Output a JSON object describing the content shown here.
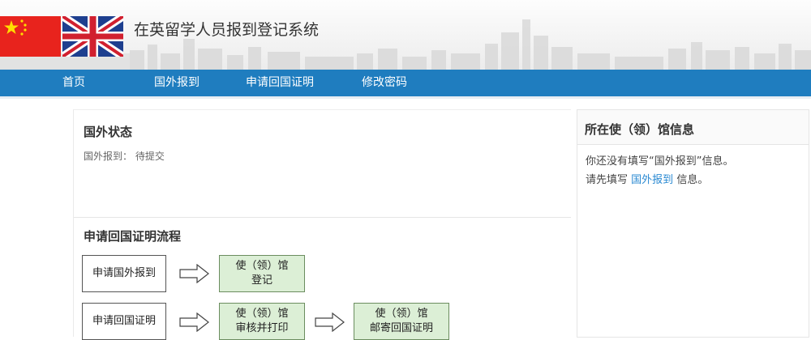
{
  "header": {
    "title": "在英留学人员报到登记系统",
    "flags": [
      "china-flag-icon",
      "uk-flag-icon"
    ]
  },
  "nav": {
    "items": [
      "首页",
      "国外报到",
      "申请回国证明",
      "修改密码"
    ]
  },
  "overseas_status": {
    "title": "国外状态",
    "label": "国外报到：",
    "value": "待提交"
  },
  "process": {
    "title": "申请回国证明流程",
    "row1": [
      "申请国外报到",
      "使（领）馆",
      "登记"
    ],
    "row2": [
      "申请回国证明",
      "使（领）馆",
      "审核并打印",
      "使（领）馆",
      "邮寄回国证明"
    ]
  },
  "embassy_info": {
    "title": "所在使（领）馆信息",
    "line1": "你还没有填写“国外报到”信息。",
    "line2_prefix": "请先填写",
    "line2_link": "国外报到",
    "line2_suffix": "信息。"
  },
  "colors": {
    "nav_bg": "#1f7dbf",
    "link": "#2b8ad2",
    "green_box": "#dcefd6"
  }
}
